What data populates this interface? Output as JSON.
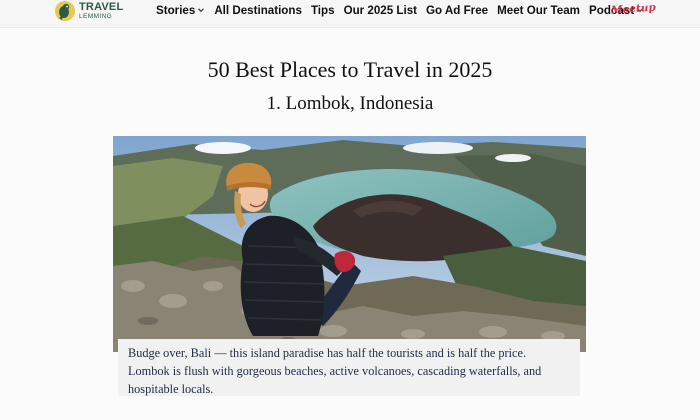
{
  "logo": {
    "line1": "TRAVEL",
    "line2": "LEMMING"
  },
  "nav": {
    "items": [
      {
        "label": "Stories",
        "dropdown": true
      },
      {
        "label": "All Destinations",
        "dropdown": false
      },
      {
        "label": "Tips",
        "dropdown": false
      },
      {
        "label": "Our 2025 List",
        "dropdown": false
      },
      {
        "label": "Go Ad Free",
        "dropdown": false
      },
      {
        "label": "Meet Our Team",
        "dropdown": false
      },
      {
        "label": "Podcast",
        "dropdown": true
      }
    ],
    "meetup_label": "Meetup"
  },
  "article": {
    "title": "50 Best Places to Travel in 2025",
    "subtitle": "1. Lombok, Indonesia",
    "caption_line1": "Budge over, Bali — this island paradise has half the tourists and is half the price.",
    "caption_line2": "Lombok is flush with gorgeous beaches, active volcanoes, cascading waterfalls, and",
    "caption_line3": "hospitable locals."
  },
  "colors": {
    "brand": "#2d5b45",
    "meetup": "#e0314b",
    "caption_text": "#1f2a44"
  }
}
